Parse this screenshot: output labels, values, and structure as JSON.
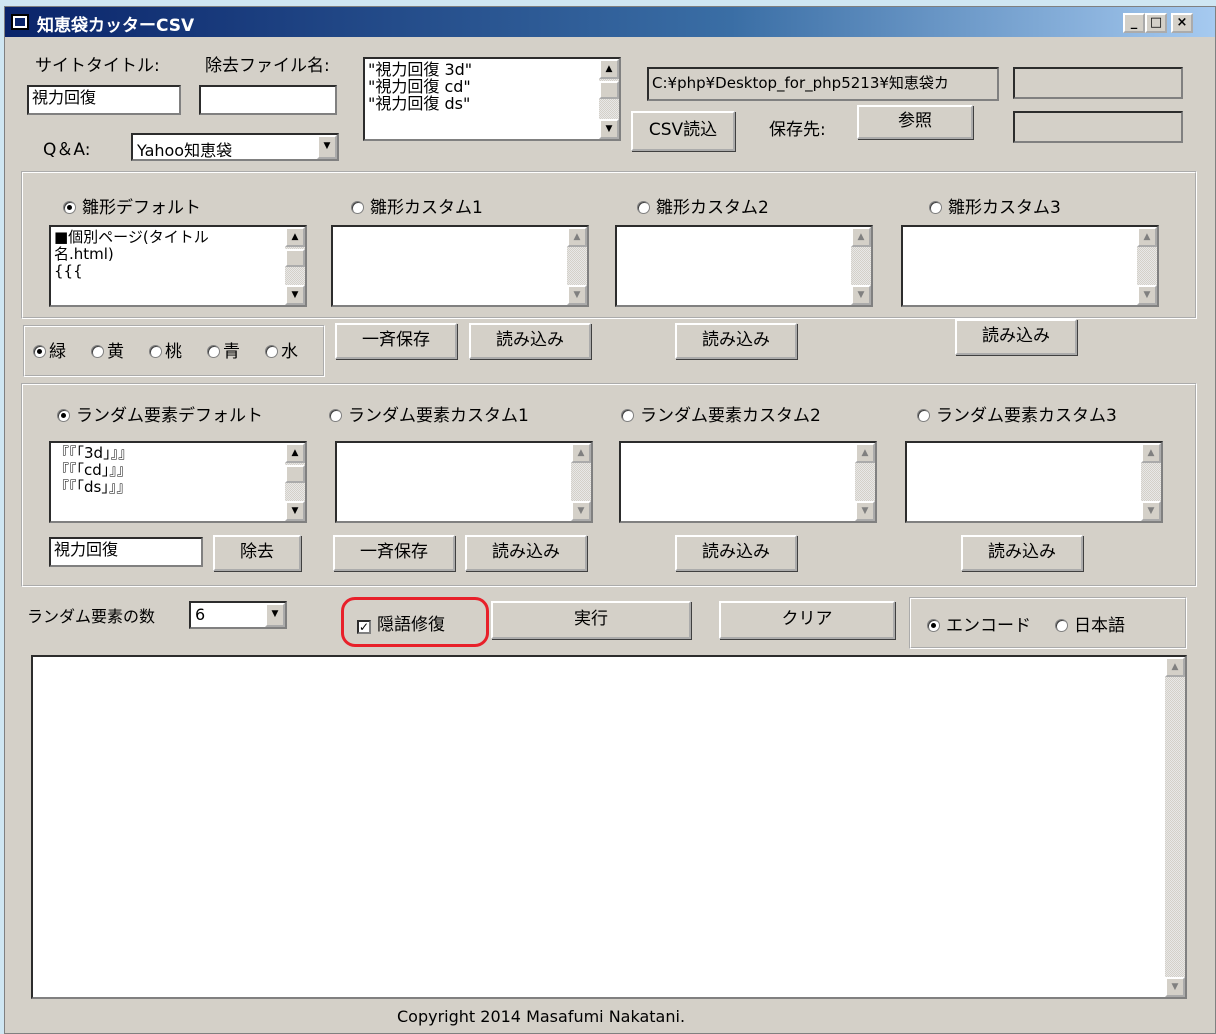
{
  "window": {
    "title": "知恵袋カッターCSV",
    "controls": {
      "minimize": "_",
      "maximize": "□",
      "close": "×"
    }
  },
  "top": {
    "site_title_label": "サイトタイトル:",
    "site_title_value": "視力回復",
    "remove_file_label": "除去ファイル名:",
    "remove_file_value": "",
    "qa_label": "Q＆A:",
    "qa_selected": "Yahoo知恵袋",
    "csv_list": "\"視力回復 3d\"\n\"視力回復 cd\"\n\"視力回復 ds\"",
    "csv_path": "C:¥php¥Desktop_for_php5213¥知恵袋カ",
    "csv_read_button": "CSV読込",
    "save_to_label": "保存先:",
    "browse_button": "参照"
  },
  "templates": {
    "options": [
      "雛形デフォルト",
      "雛形カスタム1",
      "雛形カスタム2",
      "雛形カスタム3"
    ],
    "default_text": "■個別ページ(タイトル\n名.html)\n{{{",
    "colors": [
      "緑",
      "黄",
      "桃",
      "青",
      "水"
    ],
    "save_all_button": "一斉保存",
    "load_button": "読み込み"
  },
  "random": {
    "options": [
      "ランダム要素デフォルト",
      "ランダム要素カスタム1",
      "ランダム要素カスタム2",
      "ランダム要素カスタム3"
    ],
    "default_text": "『『「3d」』』\n『『「cd」』』\n『『「ds」』』",
    "remove_value": "視力回復",
    "remove_button": "除去",
    "save_all_button": "一斉保存",
    "load_button": "読み込み"
  },
  "controls": {
    "count_label": "ランダム要素の数",
    "count_value": "6",
    "slang_checkbox": "隠語修復",
    "run_button": "実行",
    "clear_button": "クリア",
    "encode_radio": "エンコード",
    "japanese_radio": "日本語"
  },
  "output": {
    "text": ""
  },
  "footer": {
    "copyright": "Copyright 2014 Masafumi Nakatani."
  },
  "accent": {
    "highlight": "#e8202a",
    "title_bar": "#0a246a"
  },
  "icons": {
    "up": "▲",
    "down": "▼"
  }
}
